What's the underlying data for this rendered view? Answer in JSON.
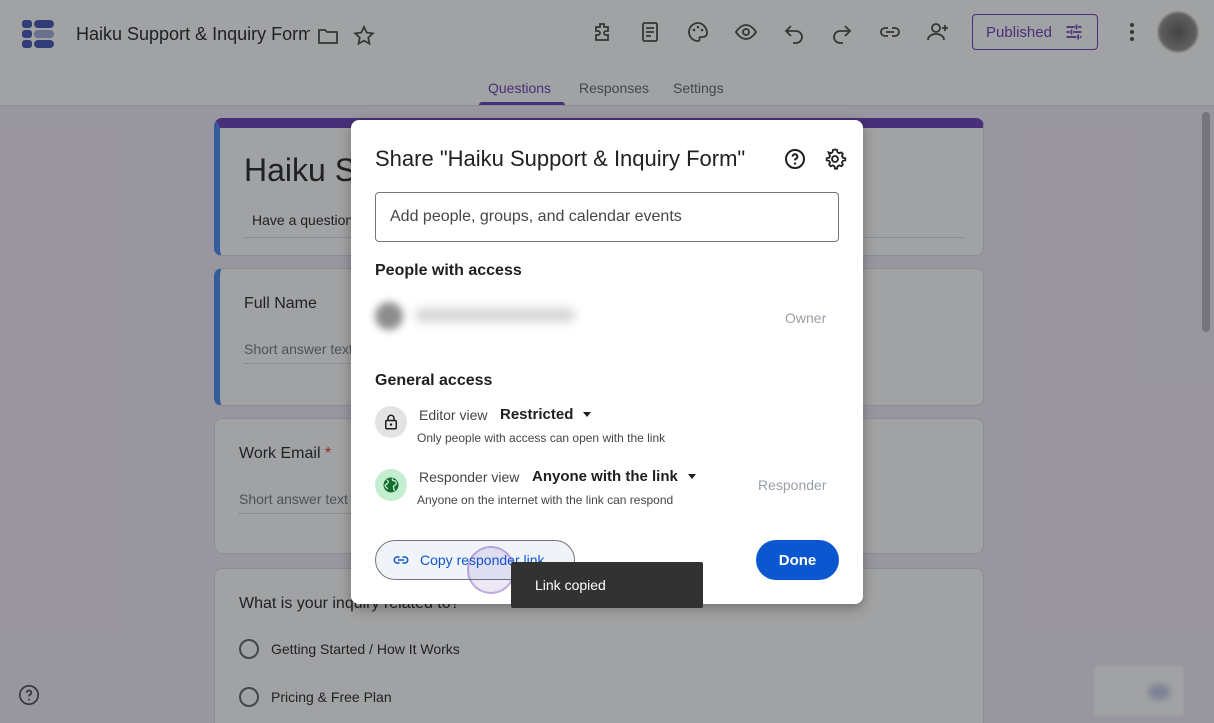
{
  "app": {
    "doc_title": "Haiku Support & Inquiry Form",
    "published_label": "Published",
    "accent_color": "#673ab7"
  },
  "toolbar": {
    "icons": [
      "addons-icon",
      "question-bank-icon",
      "palette-icon",
      "preview-icon",
      "undo-icon",
      "redo-icon",
      "link-icon",
      "add-collaborator-icon"
    ]
  },
  "tabs": [
    {
      "label": "Questions",
      "active": true
    },
    {
      "label": "Responses",
      "active": false
    },
    {
      "label": "Settings",
      "active": false
    }
  ],
  "form": {
    "title": "Haiku Su",
    "description": "Have a question",
    "questions": [
      {
        "label": "Full Name",
        "required": false,
        "placeholder": "Short answer text"
      },
      {
        "label": "Work Email",
        "required": true,
        "placeholder": "Short answer text"
      },
      {
        "label": "What is your inquiry related to?",
        "options": [
          "Getting Started / How It Works",
          "Pricing & Free Plan"
        ]
      }
    ]
  },
  "share_dialog": {
    "title": "Share \"Haiku Support & Inquiry Form\"",
    "add_people_placeholder": "Add people, groups, and calendar events",
    "people_heading": "People with access",
    "owner_role": "Owner",
    "general_heading": "General access",
    "editor": {
      "label": "Editor view",
      "value": "Restricted",
      "description": "Only people with access can open with the link"
    },
    "responder": {
      "label": "Responder view",
      "value": "Anyone with the link",
      "description": "Anyone on the internet with the link can respond",
      "role": "Responder"
    },
    "copy_link_label": "Copy responder link",
    "done_label": "Done"
  },
  "toast": {
    "message": "Link copied"
  }
}
